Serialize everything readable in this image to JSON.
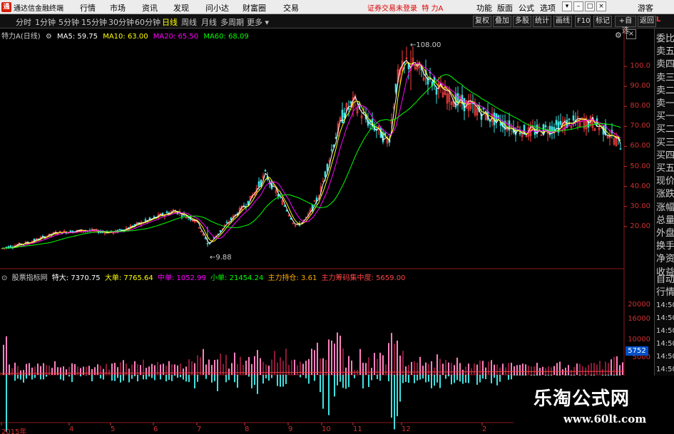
{
  "app": {
    "name": "通达信金融终端",
    "menu": [
      "行情",
      "市场",
      "资讯",
      "发现",
      "问小达",
      "财富圈",
      "交易"
    ],
    "notice": "证券交易未登录",
    "stock_title": "特 力A",
    "right_menu": [
      "功能",
      "版面",
      "公式",
      "选项"
    ],
    "guest": "游客"
  },
  "toolbar": {
    "periods": [
      "分时",
      "1分钟",
      "5分钟",
      "15分钟",
      "30分钟",
      "60分钟",
      "日线",
      "周线",
      "月线",
      "多周期",
      "更多"
    ],
    "active_period": "日线",
    "buttons": [
      "复权",
      "叠加",
      "多股",
      "统计",
      "画线",
      "F10",
      "标记",
      "+自选",
      "返回"
    ]
  },
  "main_chart": {
    "stock": "特力A(日线)",
    "ma": [
      {
        "label": "MA5:",
        "value": "59.75",
        "color": "#ffffff"
      },
      {
        "label": "MA10:",
        "value": "63.00",
        "color": "#ffff00"
      },
      {
        "label": "MA20:",
        "value": "65.50",
        "color": "#ff00ff"
      },
      {
        "label": "MA60:",
        "value": "68.09",
        "color": "#00ff00"
      }
    ],
    "peak_high": "108.00",
    "low_mark": "9.88",
    "y_ticks": [
      "100.0",
      "90.00",
      "80.00",
      "70.00",
      "60.00",
      "50.00",
      "40.00",
      "30.00",
      "20.00"
    ]
  },
  "indicator": {
    "name": "股票指标网",
    "items": [
      {
        "label": "特大:",
        "value": "7370.75",
        "color": "#ffffff"
      },
      {
        "label": "大单:",
        "value": "7765.64",
        "color": "#ffff00"
      },
      {
        "label": "中单:",
        "value": "1052.99",
        "color": "#ff00ff"
      },
      {
        "label": "小单:",
        "value": "21454.24",
        "color": "#00ff00"
      },
      {
        "label": "主力持仓:",
        "value": "3.61",
        "color": "#ffaa00"
      },
      {
        "label": "主力筹码集中度:",
        "value": "5659.00",
        "color": "#ff4444"
      }
    ],
    "y_ticks": [
      "20000",
      "16000",
      "10000",
      "5000"
    ],
    "current_value": "5752"
  },
  "x_labels": [
    "2015年",
    "4",
    "5",
    "6",
    "7",
    "8",
    "9",
    "10",
    "11",
    "12",
    "2",
    "3"
  ],
  "side_panel": {
    "items": [
      "委比",
      "卖五",
      "卖四",
      "卖三",
      "卖二",
      "卖一",
      "买一",
      "买二",
      "买三",
      "买四",
      "买五",
      "现价",
      "涨跌",
      "涨幅",
      "总量",
      "外盘",
      "换手",
      "净资",
      "收益"
    ],
    "bottom_items": [
      "自动",
      "行情"
    ],
    "times": [
      "14:50",
      "14:50",
      "14:50",
      "14:50",
      "14:50",
      "14:50",
      "14:50"
    ]
  },
  "watermark": {
    "title": "乐淘公式网",
    "url": "www.60lt.com"
  },
  "colors": {
    "up": "#ff4040",
    "down": "#40e0e0",
    "bar_pos": "#ff80c0",
    "bar_neg": "#40e0e0",
    "axis": "#d03030"
  }
}
